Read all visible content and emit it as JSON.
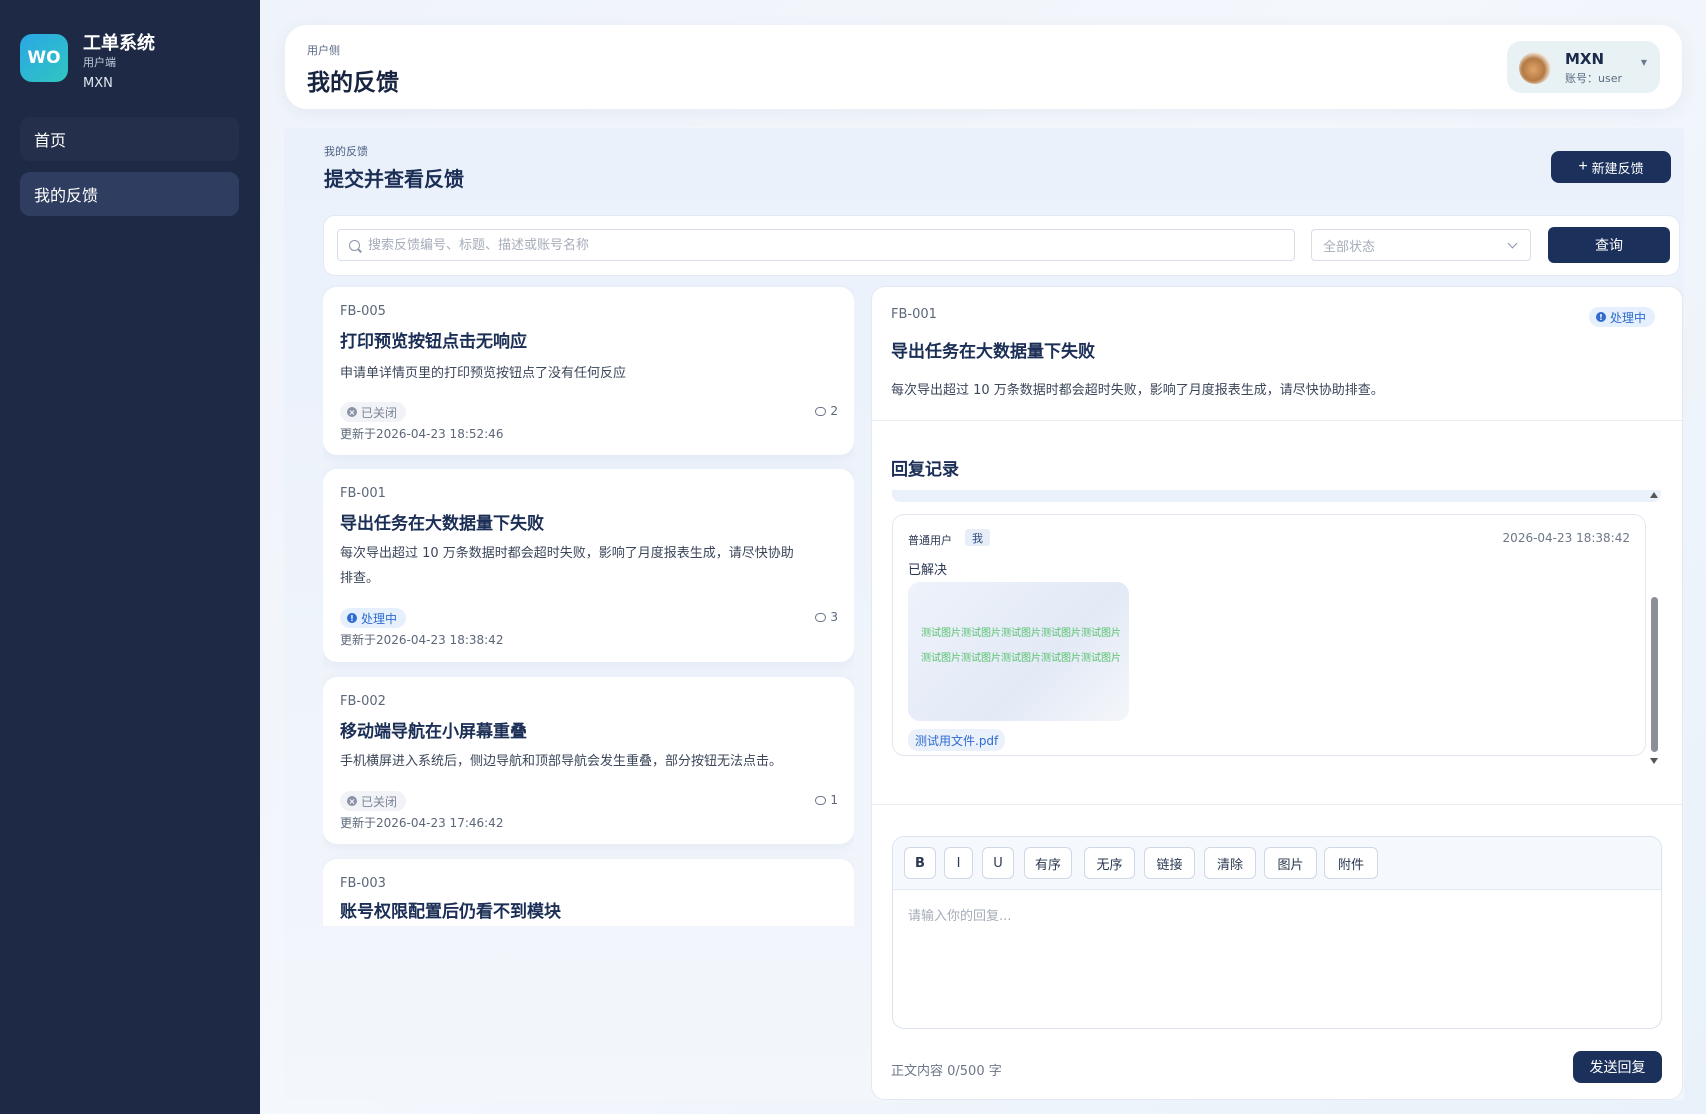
{
  "sidebar": {
    "logo": "WO",
    "title": "工单系统",
    "subtitle": "用户端",
    "user": "MXN",
    "nav": [
      {
        "label": "首页"
      },
      {
        "label": "我的反馈"
      }
    ]
  },
  "header": {
    "crumb": "用户侧",
    "title": "我的反馈",
    "user": {
      "name": "MXN",
      "account": "账号：user"
    }
  },
  "section": {
    "crumb": "我的反馈",
    "title": "提交并查看反馈",
    "new_button": "新建反馈"
  },
  "filters": {
    "search_placeholder": "搜索反馈编号、标题、描述或账号名称",
    "status_placeholder": "全部状态",
    "query_button": "查询"
  },
  "feedback_list": [
    {
      "id": "FB-005",
      "title": "打印预览按钮点击无响应",
      "desc": "申请单详情页里的打印预览按钮点了没有任何反应",
      "status": "已关闭",
      "comments": "2",
      "updated": "更新于2026-04-23 18:52:46"
    },
    {
      "id": "FB-001",
      "title": "导出任务在大数据量下失败",
      "desc_line1": "每次导出超过 10 万条数据时都会超时失败，影响了月度报表生成，请尽快协助",
      "desc_line2": "排查。",
      "status": "处理中",
      "comments": "3",
      "updated": "更新于2026-04-23 18:38:42"
    },
    {
      "id": "FB-002",
      "title": "移动端导航在小屏幕重叠",
      "desc": "手机横屏进入系统后，侧边导航和顶部导航会发生重叠，部分按钮无法点击。",
      "status": "已关闭",
      "comments": "1",
      "updated": "更新于2026-04-23 17:46:42"
    },
    {
      "id": "FB-003",
      "title": "账号权限配置后仍看不到模块"
    }
  ],
  "detail": {
    "id": "FB-001",
    "status": "处理中",
    "title": "导出任务在大数据量下失败",
    "desc": "每次导出超过 10 万条数据时都会超时失败，影响了月度报表生成，请尽快协助排查。",
    "reply_heading": "回复记录",
    "reply": {
      "role": "普通用户",
      "me_tag": "我",
      "time": "2026-04-23 18:38:42",
      "text": "已解决",
      "image_watermark": "测试图片测试图片测试图片测试图片测试图片",
      "file": "测试用文件.pdf"
    },
    "toolbar": [
      "B",
      "I",
      "U",
      "有序",
      "无序",
      "链接",
      "清除",
      "图片",
      "附件"
    ],
    "editor_placeholder": "请输入你的回复...",
    "char_count": "正文内容 0/500 字",
    "send_button": "发送回复"
  }
}
